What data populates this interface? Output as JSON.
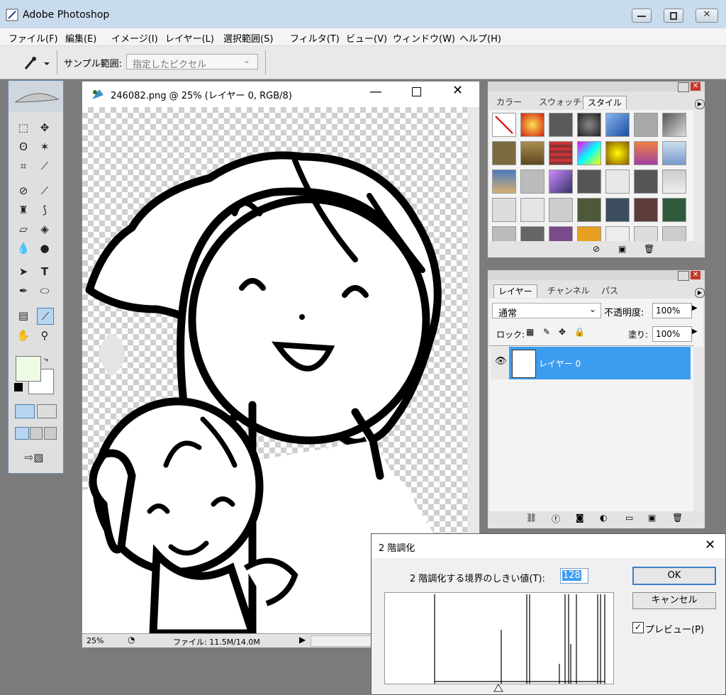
{
  "window": {
    "title": "Adobe Photoshop"
  },
  "menu": [
    "ファイル(F)",
    "編集(E)",
    "イメージ(I)",
    "レイヤー(L)",
    "選択範囲(S)",
    "フィルタ(T)",
    "ビュー(V)",
    "ウィンドウ(W)",
    "ヘルプ(H)"
  ],
  "options": {
    "sample_label": "サンプル範囲:",
    "sample_value": "指定したピクセル"
  },
  "document": {
    "title": "246082.png @ 25% (レイヤー 0, RGB/8)",
    "zoom": "25%",
    "file_info": "ファイル: 11.5M/14.0M"
  },
  "styles_panel": {
    "tabs": [
      "カラー",
      "スウォッチ",
      "スタイル"
    ]
  },
  "layers_panel": {
    "tabs": [
      "レイヤー",
      "チャンネル",
      "パス"
    ],
    "blend_mode": "通常",
    "opacity_label": "不透明度:",
    "opacity": "100%",
    "lock_label": "ロック:",
    "fill_label": "塗り:",
    "fill": "100%",
    "layer_name": "レイヤー 0"
  },
  "dialog": {
    "title": "2 階調化",
    "threshold_label": "2 階調化する境界のしきい値(T):",
    "threshold_value": "128",
    "ok": "OK",
    "cancel": "キャンセル",
    "preview": "プレビュー(P)"
  },
  "colors": {
    "accent": "#3c9cf0",
    "foreground": "#f0fbe6",
    "titlebar": "#c9dced"
  }
}
